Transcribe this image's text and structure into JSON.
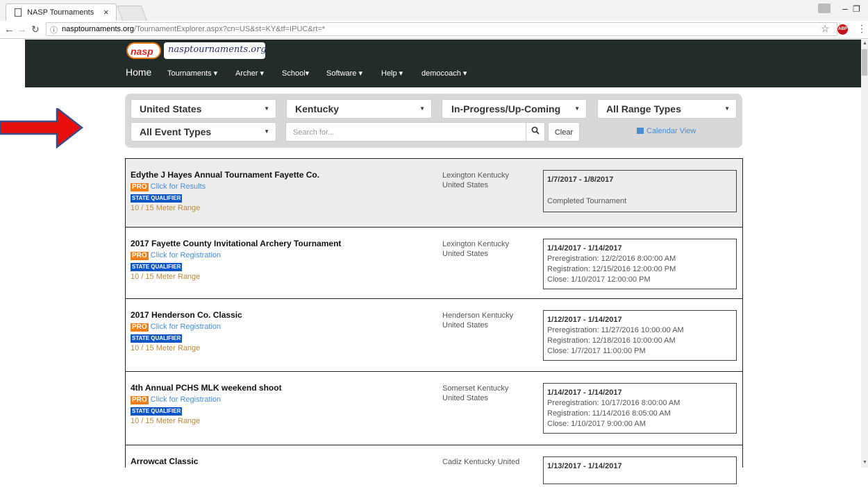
{
  "browser": {
    "tab_title": "NASP Tournaments",
    "tab_close": "×",
    "url_host": "nasptournaments.org",
    "url_path": "/TournamentExplorer.aspx?cn=US&st=KY&tf=IPUC&rt=*",
    "abp_label": "ABP"
  },
  "site": {
    "logo_text": "nasp",
    "site_name": "nasptournaments.org",
    "nav": {
      "home": "Home",
      "tournaments": "Tournaments ▾",
      "archer": "Archer ▾",
      "school": "School▾",
      "software": "Software ▾",
      "help": "Help ▾",
      "user": "democoach ▾"
    }
  },
  "filters": {
    "country": "United States",
    "state": "Kentucky",
    "timeframe": "In-Progress/Up-Coming",
    "range_type": "All Range Types",
    "event_type": "All Event Types",
    "search_placeholder": "Search for...",
    "clear_label": "Clear",
    "calendar_label": "Calendar View"
  },
  "badges": {
    "pro": "PRO",
    "qualifier": "STATE QUALIFIER"
  },
  "tournaments": [
    {
      "name": "Edythe J Hayes Annual Tournament Fayette Co.",
      "link": "Click for Results",
      "range": "10 / 15 Meter Range",
      "location_line1": "Lexington Kentucky",
      "location_line2": "United States",
      "dates": "1/7/2017  - 1/8/2017",
      "status": "Completed Tournament"
    },
    {
      "name": "2017 Fayette County Invitational Archery Tournament",
      "link": "Click for Registration",
      "range": "10 / 15 Meter Range",
      "location_line1": "Lexington Kentucky",
      "location_line2": "United States",
      "dates": "1/14/2017  - 1/14/2017",
      "preregistration": "Preregistration: 12/2/2016 8:00:00 AM",
      "registration": "Registration: 12/15/2016 12:00:00 PM",
      "close": "Close: 1/10/2017 12:00:00 PM"
    },
    {
      "name": "2017 Henderson Co. Classic",
      "link": "Click for Registration",
      "range": "10 / 15 Meter Range",
      "location_line1": "Henderson Kentucky",
      "location_line2": "United States",
      "dates": "1/12/2017  - 1/14/2017",
      "preregistration": "Preregistration: 11/27/2016 10:00:00 AM",
      "registration": "Registration: 12/18/2016 10:00:00 AM",
      "close": "Close: 1/7/2017 11:00:00 PM"
    },
    {
      "name": "4th Annual PCHS MLK weekend shoot",
      "link": "Click for Registration",
      "range": "10 / 15 Meter Range",
      "location_line1": "Somerset Kentucky",
      "location_line2": "United States",
      "dates": "1/14/2017  - 1/14/2017",
      "preregistration": "Preregistration: 10/17/2016 8:00:00 AM",
      "registration": "Registration: 11/14/2016 8:05:00 AM",
      "close": "Close: 1/10/2017 9:00:00 AM"
    },
    {
      "name": "Arrowcat Classic",
      "location_line1": "Cadiz Kentucky United",
      "dates": "1/13/2017  - 1/14/2017"
    }
  ]
}
